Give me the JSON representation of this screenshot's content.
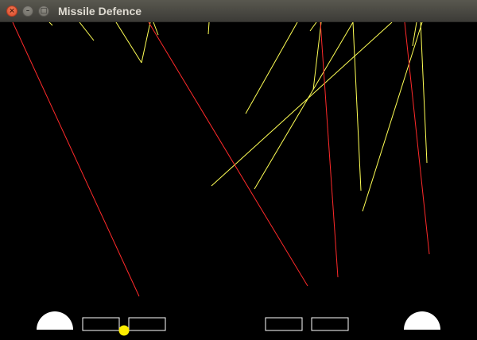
{
  "window": {
    "title": "Missile Defence",
    "close_glyph": "×",
    "minimize_glyph": "–",
    "maximize_glyph": "□"
  },
  "colors": {
    "background": "#000000",
    "incoming_missile": "#ff2a2a",
    "defence_trail": "#ffff55",
    "structure": "#ffffff",
    "interceptor": "#ffee00"
  },
  "game": {
    "bases": [
      {
        "name": "left-base"
      },
      {
        "name": "right-base"
      }
    ],
    "cities": [
      {
        "name": "city-1"
      },
      {
        "name": "city-2"
      },
      {
        "name": "city-3"
      },
      {
        "name": "city-4"
      }
    ]
  }
}
